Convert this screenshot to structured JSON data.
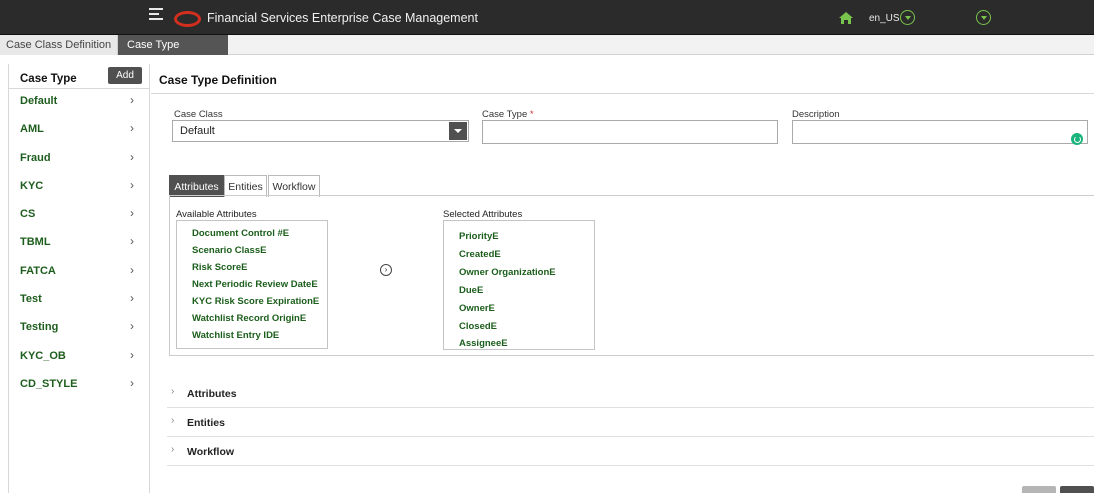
{
  "header": {
    "app_title": "Financial Services Enterprise Case Management",
    "locale": "en_US"
  },
  "main_tabs": [
    {
      "label": "Case Class Definition",
      "active": false
    },
    {
      "label": "Case Type Definition",
      "active": true
    }
  ],
  "sidebar": {
    "title": "Case Type",
    "add_label": "Add",
    "items": [
      {
        "label": "Default"
      },
      {
        "label": "AML"
      },
      {
        "label": "Fraud"
      },
      {
        "label": "KYC"
      },
      {
        "label": "CS"
      },
      {
        "label": "TBML"
      },
      {
        "label": "FATCA"
      },
      {
        "label": "Test"
      },
      {
        "label": "Testing"
      },
      {
        "label": "KYC_OB"
      },
      {
        "label": "CD_STYLE"
      }
    ]
  },
  "form": {
    "title": "Case Type Definition",
    "case_class_label": "Case Class",
    "case_class_value": "Default",
    "case_type_label": "Case Type",
    "required_mark": "*",
    "case_type_value": "",
    "description_label": "Description",
    "description_value": ""
  },
  "sub_tabs": [
    {
      "label": "Attributes",
      "active": true
    },
    {
      "label": "Entities",
      "active": false
    },
    {
      "label": "Workflow",
      "active": false
    }
  ],
  "attributes": {
    "available_label": "Available Attributes",
    "selected_label": "Selected Attributes",
    "available": [
      "Document Control #E",
      "Scenario ClassE",
      "Risk ScoreE",
      "Next Periodic Review DateE",
      "KYC Risk Score ExpirationE",
      "Watchlist Record OriginE",
      "Watchlist Entry IDE"
    ],
    "selected": [
      "PriorityE",
      "CreatedE",
      "Owner OrganizationE",
      "DueE",
      "OwnerE",
      "ClosedE",
      "AssigneeE"
    ]
  },
  "accordion": [
    {
      "label": "Attributes"
    },
    {
      "label": "Entities"
    },
    {
      "label": "Workflow"
    }
  ],
  "icons": {
    "menu": "hamburger-menu-icon",
    "logo": "oracle-logo-icon",
    "home": "home-icon",
    "move": "move-right-icon",
    "chevron": "chevron-right-icon"
  },
  "colors": {
    "header_bg": "#2b2b2b",
    "brand_red": "#d32f1e",
    "accent_green": "#79c44c",
    "link_green": "#1d5d1d",
    "button_dark": "#505050"
  }
}
